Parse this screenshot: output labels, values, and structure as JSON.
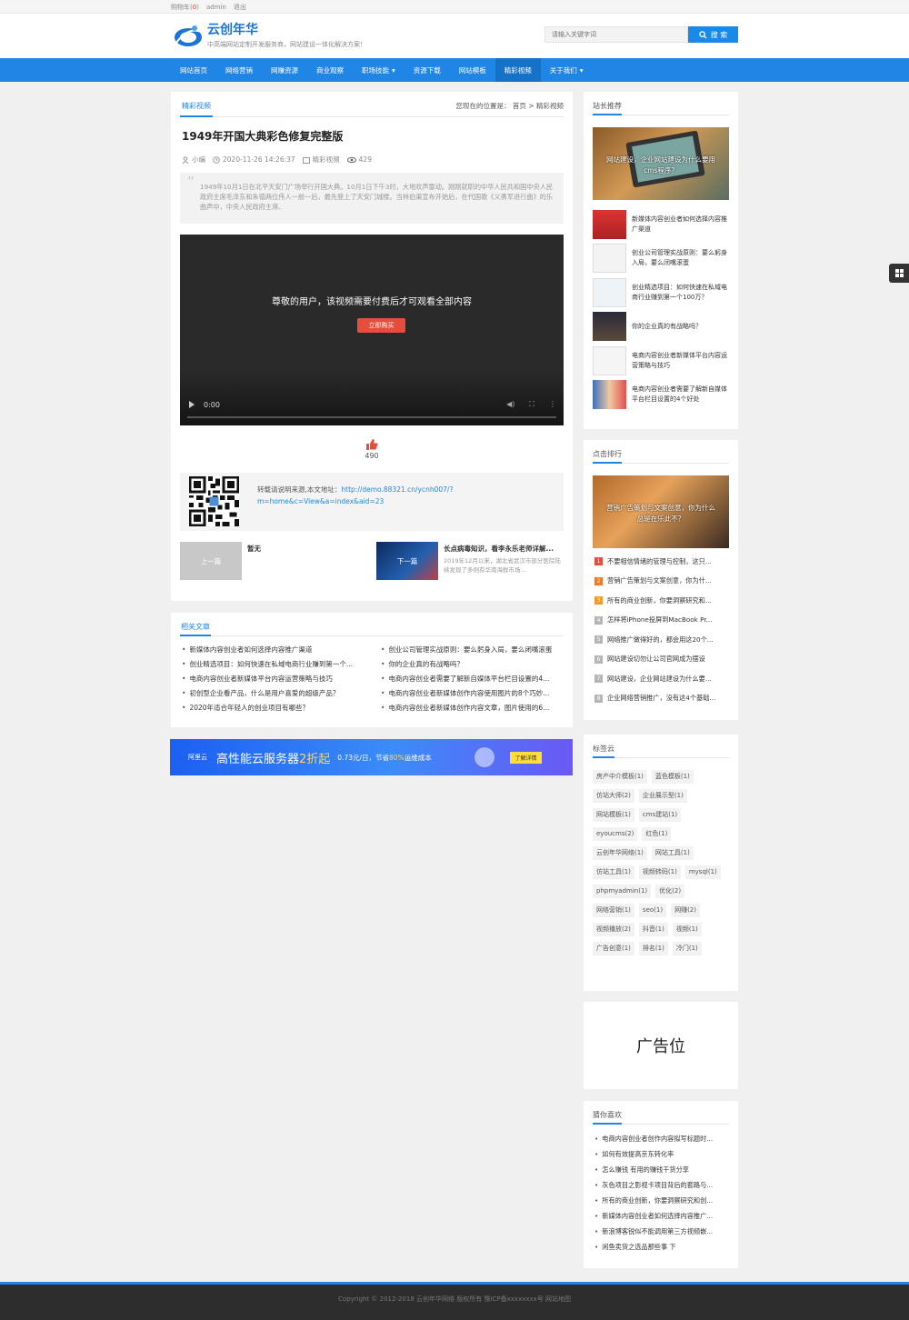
{
  "topbar": {
    "cart_label": "购物车(",
    "cart_count": "0",
    "cart_close": ")",
    "user": "admin",
    "logout": "退出"
  },
  "brand": {
    "name": "云创年华",
    "slogan": "中高端网站定制开发服务商，网站建设一体化解决方案！"
  },
  "search": {
    "placeholder": "请输入关键字词",
    "button": "搜 索"
  },
  "nav": [
    "网站首页",
    "网络营销",
    "网赚资源",
    "商业观察",
    "职场技能",
    "资源下载",
    "网站模板",
    "精彩视频",
    "关于我们"
  ],
  "colors": {
    "primary": "#1f86e6",
    "buy_button": "#e64d3a",
    "footer_bg": "#2d2d2d"
  },
  "article": {
    "category_tab": "精彩视频",
    "location_label": "您现在的位置是：",
    "crumb_home": "首页",
    "crumb_sep": ">",
    "crumb_current": "精彩视频",
    "title": "1949年开国大典彩色修复完整版",
    "author": "小编",
    "date": "2020-11-26 14:26:37",
    "category": "精彩视频",
    "views": "429",
    "summary": "1949年10月1日在北平天安门广场举行开国大典。10月1日下午3时，大地欢声雷动。刚刚就职的中华人民共和国中央人民政府主席毛泽东和朱德两位伟人一前一后，最先登上了天安门城楼。当林伯渠宣布开始后，在代国歌《义勇军进行曲》的乐曲声中，中央人民政府主席、",
    "video_msg": "尊敬的用户，该视频需要付费后才可观看全部内容",
    "buy_button": "立即购买",
    "video_time": "0:00",
    "likes": "490",
    "share_label": "转载请说明来源,本文地址：",
    "share_url": "http://demo.88321.cn/ycnh007/?m=home&c=View&a=index&aid=23",
    "prev_label": "上一篇",
    "prev_title": "暂无",
    "next_label": "下一篇",
    "next_title": "长点病毒知识，看李永乐老师详解...",
    "next_excerpt": "2019年12月以来，湖北省武汉市部分医院陆续发现了多例有华南海鲜市场..."
  },
  "related": {
    "title": "相关文章",
    "items": [
      "新媒体内容创业者如何选择内容推广渠道",
      "创业公司管理实战原则：要么躬身入局，要么闭嘴滚蛋",
      "创业精选项目：如何快速在私域电商行业赚到第一个...",
      "你的企业真的有战略吗？",
      "电商内容创业者新媒体平台内容运营策略与技巧",
      "电商内容创业者需要了解新自媒体平台栏目设置的4...",
      "初创型企业看产品，什么是用户喜爱的超级产品？",
      "电商内容创业者新媒体创作内容使用图片的8个巧妙...",
      "2020年适合年轻人的创业项目有哪些？",
      "电商内容创业者新媒体创作内容文章，图片使用的6..."
    ]
  },
  "ad_banner": {
    "brand": "阿里云",
    "headline_a": "高性能云服务器",
    "headline_b": "2折起",
    "price_a": "0.73元/日，节省",
    "price_b": "80%",
    "price_c": "运维成本",
    "cta": "了解详情"
  },
  "sidebar": {
    "recommend": {
      "title": "站长推荐",
      "hero_caption": "网站建设，企业网站建设为什么要用cms程序？",
      "items": [
        "新媒体内容创业者如何选择内容推广渠道",
        "创业公司管理实战原则：要么躬身入局，要么闭嘴滚蛋",
        "创业精选项目：如何快速在私域电商行业赚到第一个100万？",
        "你的企业真的有战略吗？",
        "电商内容创业者新媒体平台内容运营策略与技巧",
        "电商内容创业者需要了解新自媒体平台栏目设置的4个好处"
      ]
    },
    "ranking": {
      "title": "点击排行",
      "hero_caption": "营销广告策划与文案创意，你为什么总是在乐此不？",
      "items": [
        "不要相信情绪的管理与控制，这只...",
        "营销广告策划与文案创意，你为什...",
        "所有的商业创新，你要洞察研究和...",
        "怎样将iPhone投屏到MacBook Pr...",
        "网络推广做得好的，都会用这20个...",
        "网站建设切勿让公司官网成为摆设",
        "网站建设，企业网站建设为什么要...",
        "企业网络营销推广，没有这4个基础..."
      ]
    },
    "tags": {
      "title": "标签云",
      "items": [
        "房产中介模板(1)",
        "蓝色模板(1)",
        "仿站大师(2)",
        "企业展示型(1)",
        "网站模板(1)",
        "cms建站(1)",
        "eyoucms(2)",
        "红色(1)",
        "云创年华网络(1)",
        "网站工具(1)",
        "仿站工具(1)",
        "视频转码(1)",
        "mysql(1)",
        "phpmyadmin(1)",
        "优化(2)",
        "网络营销(1)",
        "seo(1)",
        "网赚(2)",
        "视频播放(2)",
        "抖音(1)",
        "视频(1)",
        "广告创意(1)",
        "排名(1)",
        "冷门(1)"
      ]
    },
    "ad_label": "广告位",
    "guess": {
      "title": "猜你喜欢",
      "items": [
        "电商内容创业者创作内容拟写标题时...",
        "如何有效提高京东转化率",
        "怎么赚钱 有用的赚钱干货分享",
        "灰色项目之影视卡项目背后的套路与...",
        "所有的商业创新，你要洞察研究和创...",
        "新媒体内容创业者如何选择内容推广...",
        "新浪博客锐似不能调用第三方视频嵌...",
        "闲鱼卖货之选品那些事 下"
      ]
    }
  },
  "footer": {
    "text": "Copyright © 2012-2018 云创年华网络 版权所有  豫ICP备xxxxxxxx号    网站地图"
  }
}
